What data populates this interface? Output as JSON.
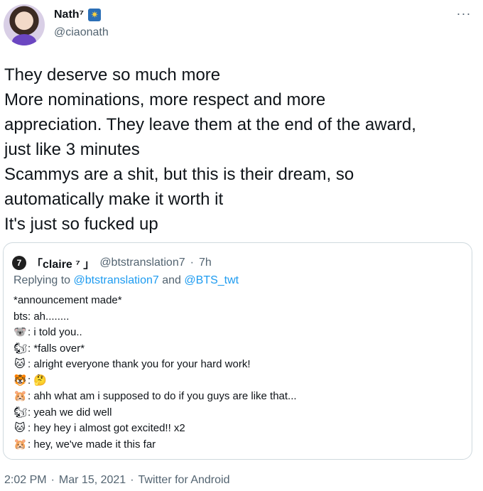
{
  "author": {
    "display_name": "Nath⁷",
    "badge_icon": "sparkle-star-emoji",
    "handle": "@ciaonath",
    "more_icon": "···"
  },
  "tweet": {
    "lines": [
      "They deserve so much more",
      "More nominations, more respect and more",
      "appreciation. They leave them at the end of the award,",
      "just like 3 minutes",
      "Scammys are a shit, but this is their dream, so",
      "automatically make it worth it",
      "It's just so fucked up"
    ]
  },
  "quote": {
    "avatar_label": "7",
    "display_name": "「claire ⁷ 」",
    "handle": "@btstranslation7",
    "separator": "·",
    "time": "7h",
    "replying_prefix": "Replying to ",
    "replying_mention_1": "@btstranslation7",
    "replying_and": " and ",
    "replying_mention_2": "@BTS_twt",
    "lines": [
      {
        "emoji": "",
        "text": "*announcement made*"
      },
      {
        "emoji": "",
        "text": "bts: ah........"
      },
      {
        "emoji": "🐨",
        "text": ": i told you.."
      },
      {
        "emoji": "🐿",
        "text": ": *falls over*"
      },
      {
        "emoji": "🐱",
        "text": ": alright everyone thank you for your hard work!"
      },
      {
        "emoji": "🐯",
        "text": ": 🤔"
      },
      {
        "emoji": "🐹",
        "text": ": ahh what am i supposed to do if you guys are like that..."
      },
      {
        "emoji": "🐿",
        "text": ": yeah we did well"
      },
      {
        "emoji": "🐱",
        "text": ": hey hey i almost got excited!! x2"
      },
      {
        "emoji": "🐹",
        "text": ": hey, we've made it this far"
      }
    ]
  },
  "footer": {
    "time": "2:02 PM",
    "separator": "·",
    "date": "Mar 15, 2021",
    "source": "Twitter for Android"
  }
}
